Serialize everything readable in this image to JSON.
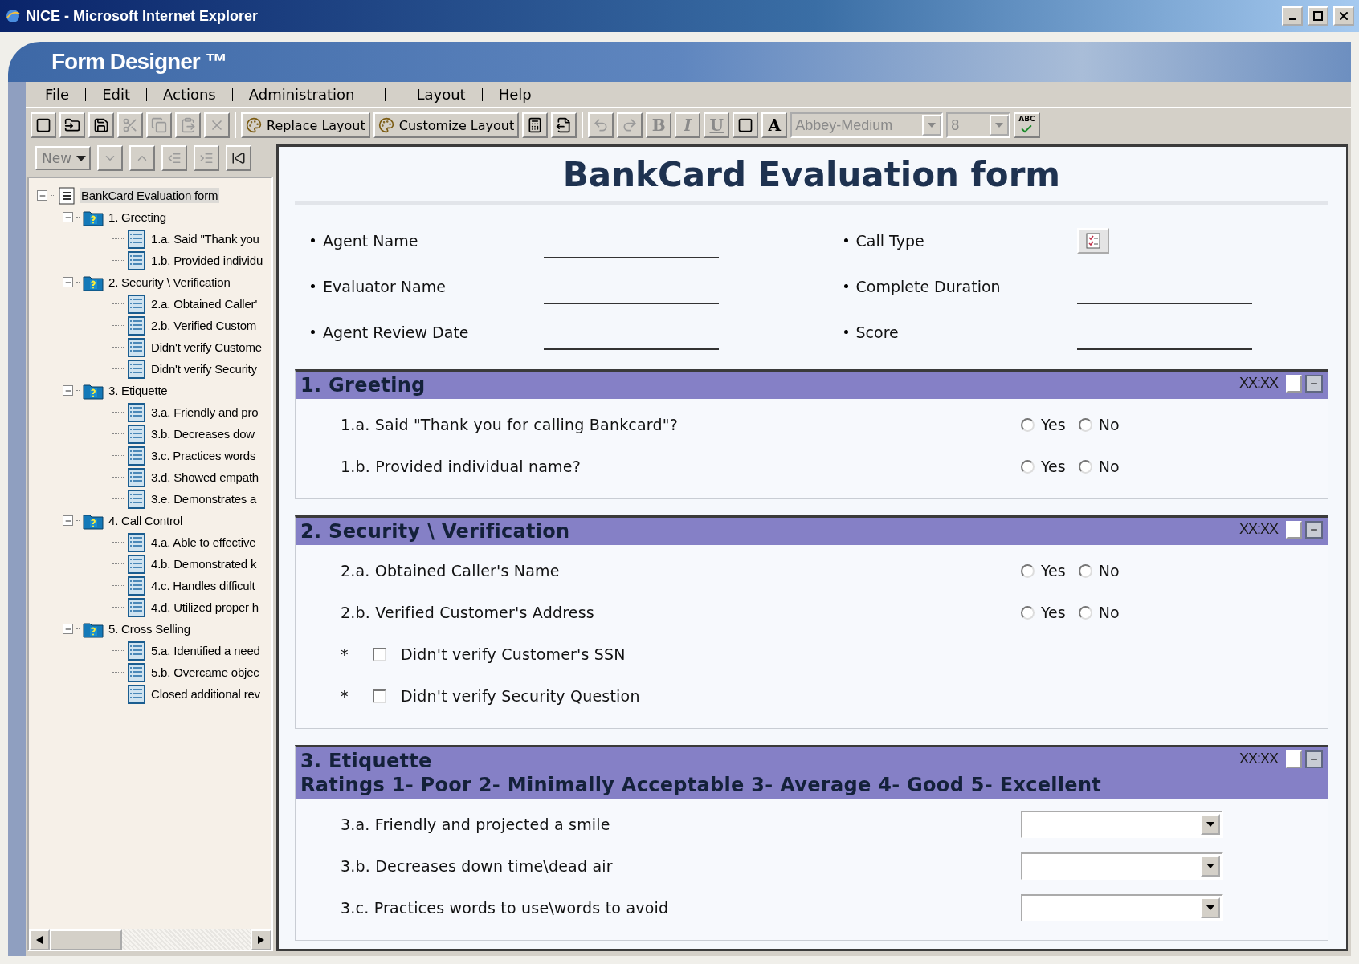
{
  "window": {
    "title": "NICE - Microsoft Internet Explorer"
  },
  "app": {
    "title": "Form Designer ™"
  },
  "menu": [
    "File",
    "Edit",
    "Actions",
    "Administration",
    "Layout",
    "Help"
  ],
  "toolbar": {
    "file_tools": [
      {
        "disabled": false
      },
      {
        "disabled": false
      },
      {
        "disabled": false
      },
      {
        "disabled": true
      },
      {
        "disabled": true
      },
      {
        "disabled": true
      },
      {
        "disabled": true
      }
    ],
    "layout_buttons": [
      {
        "label": "Replace Layout"
      },
      {
        "label": "Customize Layout"
      }
    ],
    "layout_tools": [
      {
        "disabled": false
      },
      {
        "disabled": false
      }
    ],
    "format_tools": [
      {
        "kind": "icon",
        "disabled": true
      },
      {
        "kind": "icon",
        "disabled": true
      },
      {
        "kind": "letter",
        "label": "B",
        "disabled": true
      },
      {
        "kind": "letter",
        "label": "I",
        "disabled": true
      },
      {
        "kind": "letter",
        "label": "U",
        "disabled": true
      },
      {
        "kind": "icon",
        "disabled": false
      },
      {
        "kind": "letter",
        "label": "A",
        "disabled": false
      }
    ],
    "font": {
      "value": "Abbey-Medium",
      "disabled": true
    },
    "size": {
      "value": "8",
      "disabled": true
    },
    "spell": {
      "label": "ABC"
    }
  },
  "tree_toolbar": {
    "new_button": {
      "label": "New"
    },
    "tools": [
      {
        "disabled": true
      },
      {
        "disabled": true
      },
      {
        "disabled": true
      },
      {
        "disabled": true
      },
      {
        "disabled": false
      }
    ]
  },
  "tree": {
    "label": "BankCard Evaluation form",
    "expanded": true,
    "selected": true,
    "children": [
      {
        "label": "1. Greeting",
        "expanded": true,
        "selected": false,
        "children": [
          {
            "label": "1.a. Said \"Thank you",
            "selected": false
          },
          {
            "label": "1.b. Provided individu",
            "selected": false
          }
        ]
      },
      {
        "label": "2. Security \\ Verification",
        "expanded": true,
        "selected": false,
        "children": [
          {
            "label": "2.a. Obtained Caller'",
            "selected": false
          },
          {
            "label": "2.b. Verified Custom",
            "selected": false
          },
          {
            "label": "Didn't verify Custome",
            "selected": false
          },
          {
            "label": "Didn't verify Security",
            "selected": false
          }
        ]
      },
      {
        "label": "3. Etiquette",
        "expanded": true,
        "selected": false,
        "children": [
          {
            "label": "3.a. Friendly and pro",
            "selected": false
          },
          {
            "label": "3.b. Decreases dow",
            "selected": false
          },
          {
            "label": "3.c. Practices words",
            "selected": false
          },
          {
            "label": "3.d. Showed empath",
            "selected": false
          },
          {
            "label": "3.e. Demonstrates a",
            "selected": false
          }
        ]
      },
      {
        "label": "4. Call Control",
        "expanded": true,
        "selected": false,
        "children": [
          {
            "label": "4.a. Able to effective",
            "selected": false
          },
          {
            "label": "4.b. Demonstrated k",
            "selected": false
          },
          {
            "label": "4.c. Handles difficult",
            "selected": false
          },
          {
            "label": "4.d. Utilized proper h",
            "selected": false
          }
        ]
      },
      {
        "label": "5. Cross Selling",
        "expanded": true,
        "selected": false,
        "children": [
          {
            "label": "5.a. Identified a need",
            "selected": false
          },
          {
            "label": "5.b. Overcame objec",
            "selected": false
          },
          {
            "label": "Closed additional rev",
            "selected": false
          }
        ]
      }
    ]
  },
  "form": {
    "title": "BankCard Evaluation form",
    "fields_left": [
      {
        "label": "Agent Name",
        "kind": "line"
      },
      {
        "label": "Evaluator Name",
        "kind": "line"
      },
      {
        "label": "Agent Review Date",
        "kind": "line"
      }
    ],
    "fields_right": [
      {
        "label": "Call Type",
        "kind": "picker"
      },
      {
        "label": "Complete Duration",
        "kind": "line"
      },
      {
        "label": "Score",
        "kind": "line"
      }
    ],
    "sections": [
      {
        "title": "1. Greeting",
        "time": "XX:XX",
        "checked": false,
        "questions": [
          {
            "kind": "yesno",
            "text": "1.a. Said \"Thank you for calling Bankcard\"?",
            "options": [
              {
                "label": "Yes",
                "selected": false
              },
              {
                "label": "No",
                "selected": false
              }
            ]
          },
          {
            "kind": "yesno",
            "text": "1.b. Provided individual name?",
            "options": [
              {
                "label": "Yes",
                "selected": false
              },
              {
                "label": "No",
                "selected": false
              }
            ]
          }
        ]
      },
      {
        "title": "2. Security \\ Verification",
        "time": "XX:XX",
        "checked": false,
        "questions": [
          {
            "kind": "yesno",
            "text": "2.a. Obtained Caller's Name",
            "options": [
              {
                "label": "Yes",
                "selected": false
              },
              {
                "label": "No",
                "selected": false
              }
            ]
          },
          {
            "kind": "yesno",
            "text": "2.b. Verified Customer's Address",
            "options": [
              {
                "label": "Yes",
                "selected": false
              },
              {
                "label": "No",
                "selected": false
              }
            ]
          },
          {
            "kind": "checkbox",
            "marker": "*",
            "text": "Didn't verify Customer's SSN",
            "checked": false
          },
          {
            "kind": "checkbox",
            "marker": "*",
            "text": "Didn't verify Security Question",
            "checked": false
          }
        ]
      },
      {
        "title": "3. Etiquette",
        "subtitle": "Ratings 1- Poor  2- Minimally Acceptable 3- Average 4- Good 5- Excellent",
        "time": "XX:XX",
        "checked": false,
        "questions": [
          {
            "kind": "dropdown",
            "text": "3.a. Friendly and projected a smile"
          },
          {
            "kind": "dropdown",
            "text": "3.b. Decreases down time\\dead air"
          },
          {
            "kind": "dropdown",
            "text": "3.c. Practices words to use\\words to avoid"
          }
        ]
      }
    ]
  }
}
